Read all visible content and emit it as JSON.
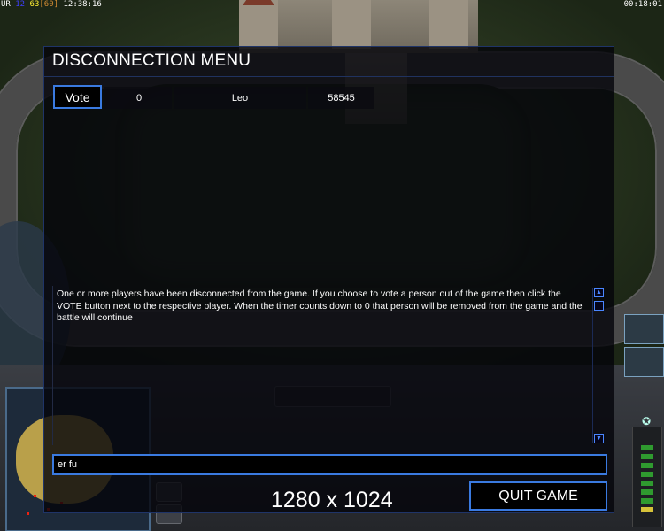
{
  "hud": {
    "top_left": {
      "a": "UR",
      "b": "12",
      "c": "63",
      "d": "[60]",
      "e": "12:38:16"
    },
    "top_right": "00:18:01"
  },
  "menu": {
    "title": "DISCONNECTION MENU",
    "players": [
      {
        "vote_label": "Vote",
        "votes": "0",
        "name": "Leo",
        "ping": "58545"
      }
    ],
    "message": "One or more players have been disconnected from the game. If you choose to vote a person out of the game then click the VOTE button next to the respective player. When the timer counts down to 0 that person will be removed from the game and the battle will continue",
    "chat_value": "er fu",
    "resolution": "1280 x 1024",
    "quit_label": "QUIT GAME"
  },
  "colors": {
    "accent_border": "#3a7ae0",
    "panel_bg": "#04040acc",
    "text": "#ffffff"
  },
  "icons": [
    "scroll-up-icon",
    "scroll-down-icon",
    "scroll-thumb",
    "power-star-icon"
  ]
}
